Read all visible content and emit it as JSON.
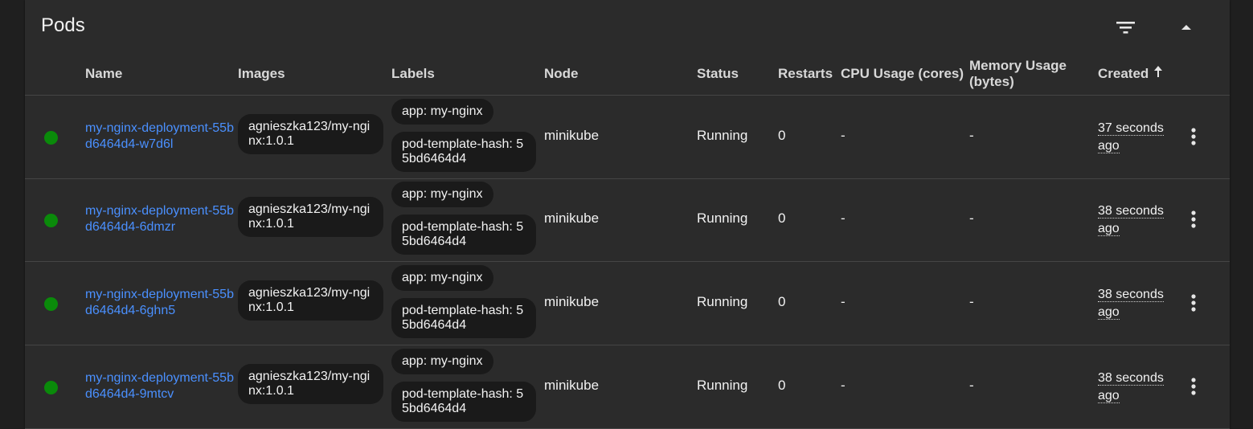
{
  "card": {
    "title": "Pods",
    "filter_icon": "filter-list-icon",
    "collapse_icon": "chevron-up-icon"
  },
  "columns": {
    "name": "Name",
    "images": "Images",
    "labels": "Labels",
    "node": "Node",
    "status": "Status",
    "restarts": "Restarts",
    "cpu": "CPU Usage (cores)",
    "memory_line1": "Memory Usage",
    "memory_line2": "(bytes)",
    "created": "Created",
    "created_sort_icon": "arrow-up-icon"
  },
  "colors": {
    "link": "#4a90ff",
    "status_ok": "#0a8a0a",
    "card_bg": "#2b2b2b",
    "chip_bg": "#1a1a1a"
  },
  "rows": [
    {
      "name": "my-nginx-deployment-55bd6464d4-w7d6l",
      "image": "agnieszka123/my-nginx:1.0.1",
      "label1": "app: my-nginx",
      "label2": "pod-template-hash: 55bd6464d4",
      "node": "minikube",
      "status": "Running",
      "restarts": "0",
      "cpu": "-",
      "memory": "-",
      "created": "37 seconds ago"
    },
    {
      "name": "my-nginx-deployment-55bd6464d4-6dmzr",
      "image": "agnieszka123/my-nginx:1.0.1",
      "label1": "app: my-nginx",
      "label2": "pod-template-hash: 55bd6464d4",
      "node": "minikube",
      "status": "Running",
      "restarts": "0",
      "cpu": "-",
      "memory": "-",
      "created": "38 seconds ago"
    },
    {
      "name": "my-nginx-deployment-55bd6464d4-6ghn5",
      "image": "agnieszka123/my-nginx:1.0.1",
      "label1": "app: my-nginx",
      "label2": "pod-template-hash: 55bd6464d4",
      "node": "minikube",
      "status": "Running",
      "restarts": "0",
      "cpu": "-",
      "memory": "-",
      "created": "38 seconds ago"
    },
    {
      "name": "my-nginx-deployment-55bd6464d4-9mtcv",
      "image": "agnieszka123/my-nginx:1.0.1",
      "label1": "app: my-nginx",
      "label2": "pod-template-hash: 55bd6464d4",
      "node": "minikube",
      "status": "Running",
      "restarts": "0",
      "cpu": "-",
      "memory": "-",
      "created": "38 seconds ago"
    }
  ]
}
